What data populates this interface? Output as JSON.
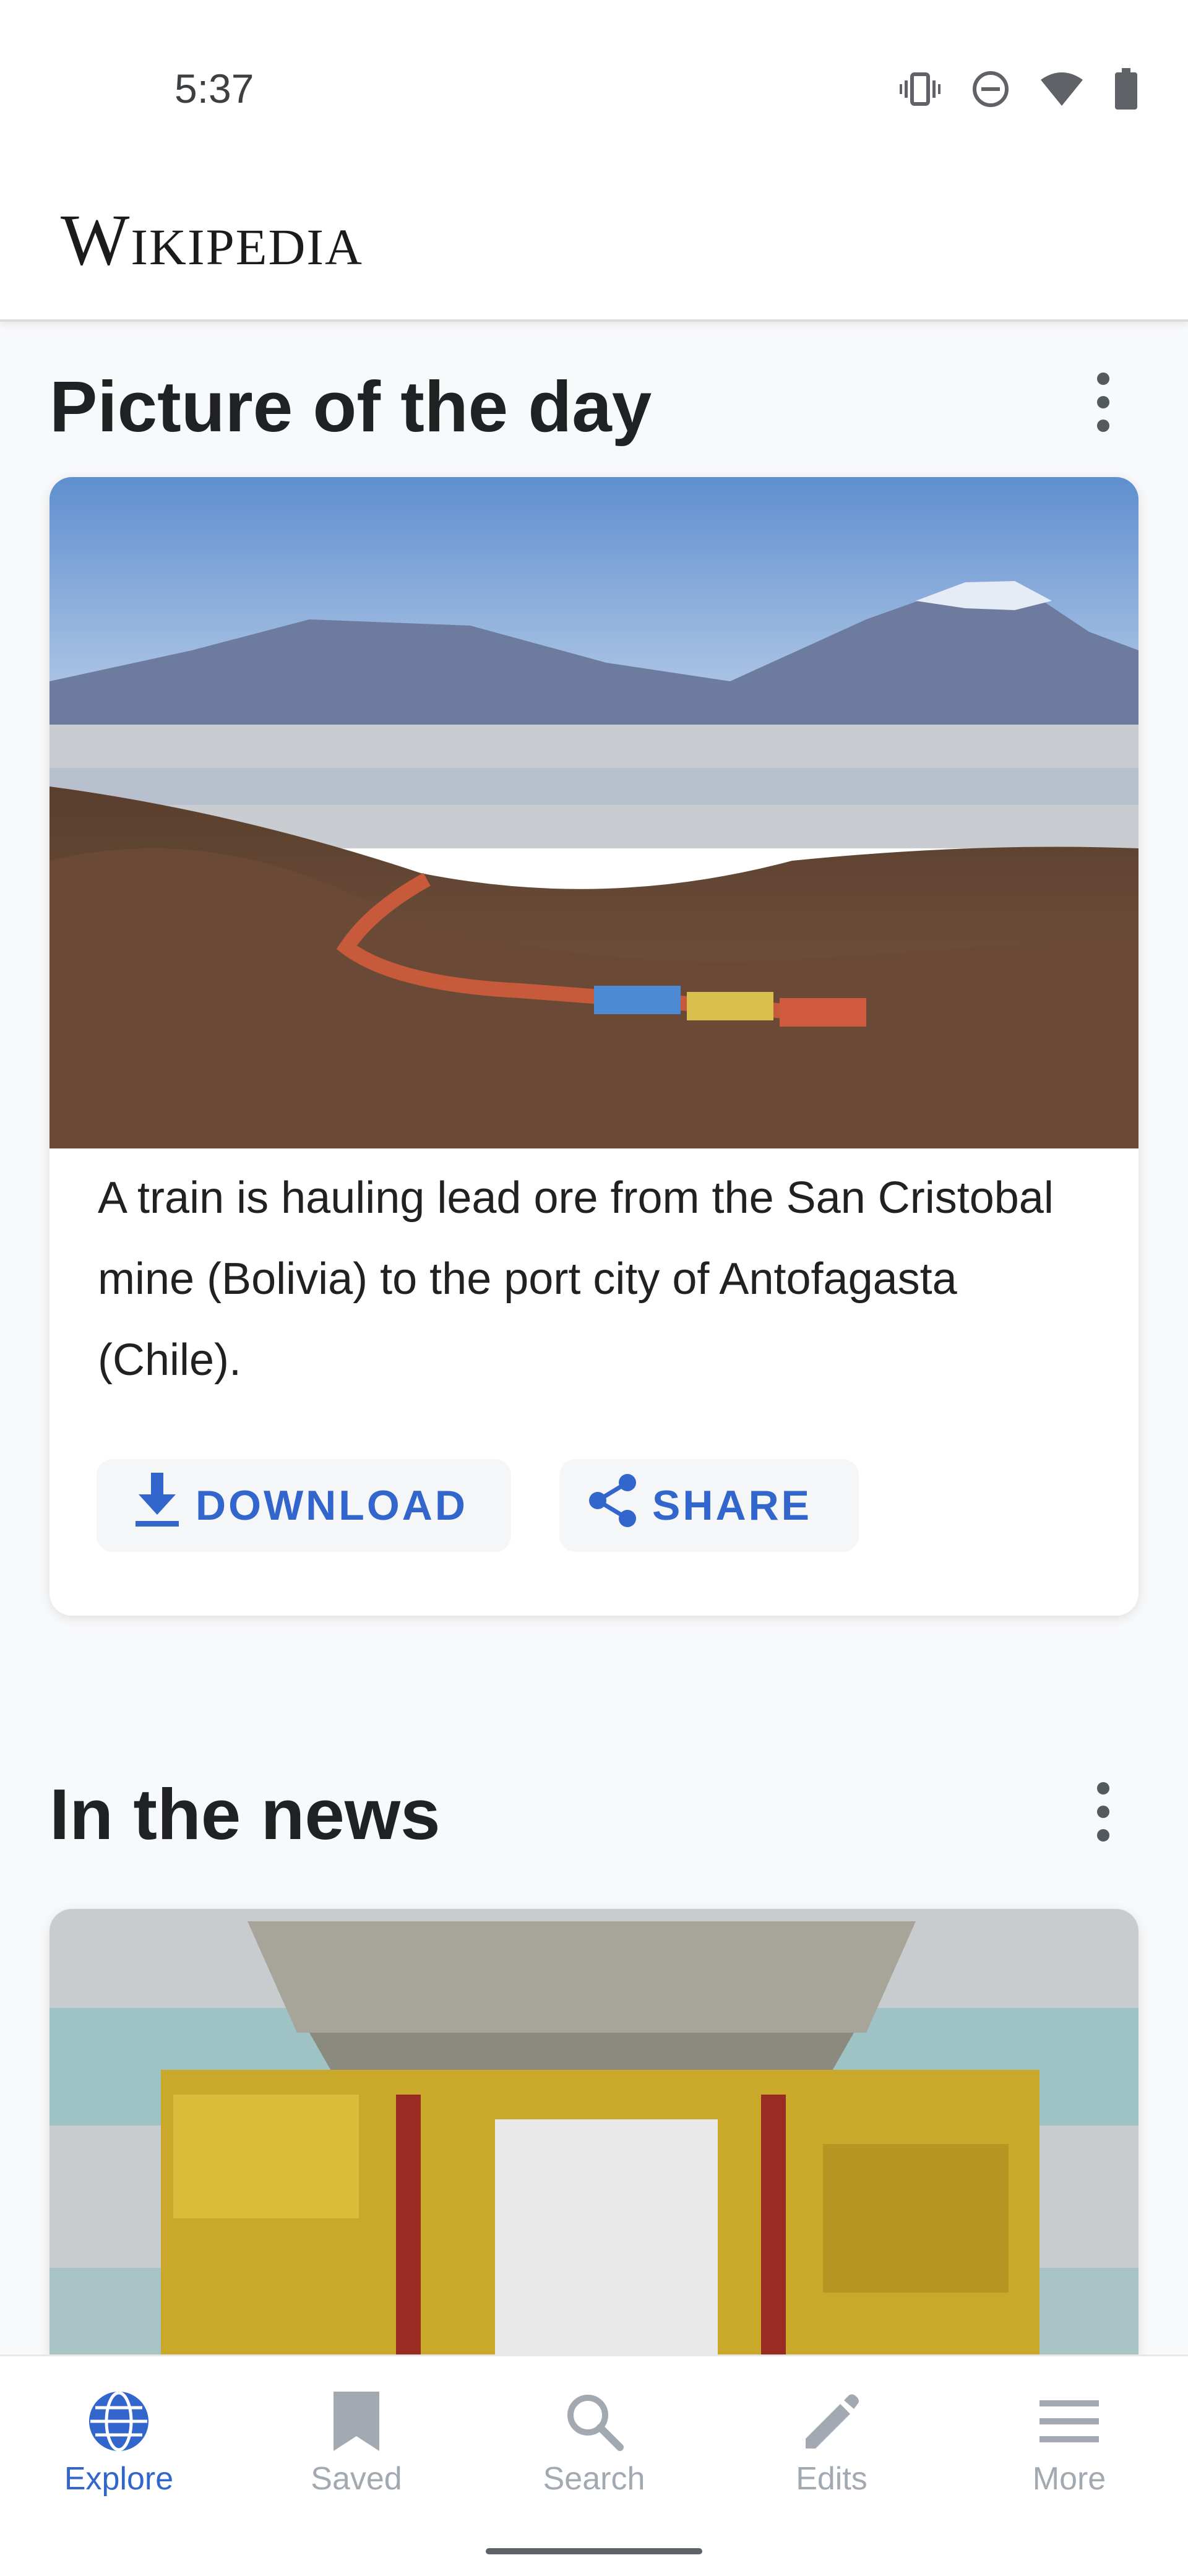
{
  "status_bar": {
    "time": "5:37",
    "icons": [
      "vibrate-icon",
      "do-not-disturb-icon",
      "wifi-icon",
      "battery-icon"
    ]
  },
  "app_bar": {
    "title": "Wikipedia"
  },
  "picture_of_the_day": {
    "heading": "Picture of the day",
    "caption": "A train is hauling lead ore from the San Cristobal mine (Bolivia) to the port city of Antofagasta (Chile).",
    "download_label": "DOWNLOAD",
    "share_label": "SHARE"
  },
  "in_the_news": {
    "heading": "In the news"
  },
  "bottom_nav": {
    "items": [
      {
        "label": "Explore",
        "icon": "globe-icon",
        "active": true
      },
      {
        "label": "Saved",
        "icon": "bookmark-icon",
        "active": false
      },
      {
        "label": "Search",
        "icon": "search-icon",
        "active": false
      },
      {
        "label": "Edits",
        "icon": "pencil-icon",
        "active": false
      },
      {
        "label": "More",
        "icon": "menu-icon",
        "active": false
      }
    ]
  },
  "colors": {
    "accent": "#3366cc",
    "inactive": "#a2a9b1",
    "background": "#f8f9fa"
  }
}
